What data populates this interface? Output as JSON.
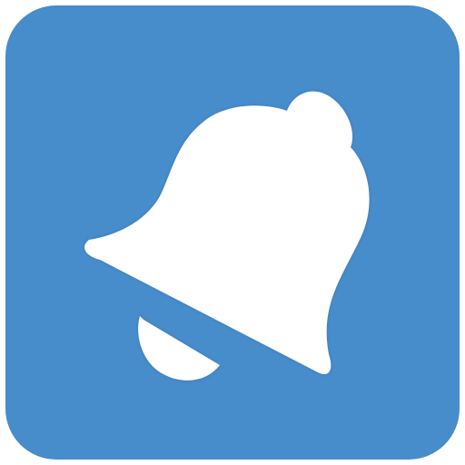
{
  "app_icon": {
    "icon": "bell-icon",
    "colors": {
      "tile": "#478ccb",
      "glyph": "#ffffff"
    }
  }
}
